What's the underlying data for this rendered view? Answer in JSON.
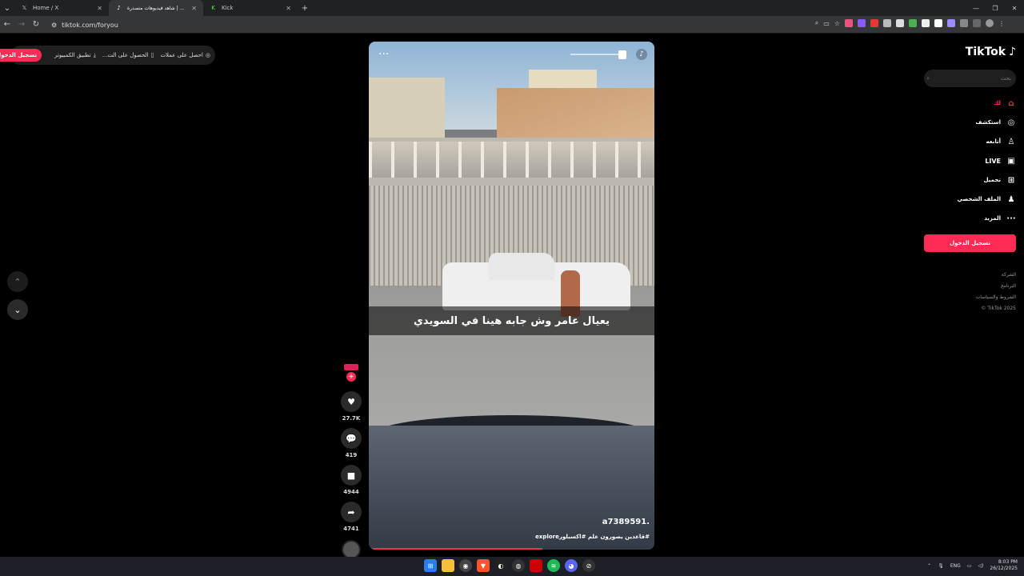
{
  "browser": {
    "tabs": [
      {
        "title": "Home / X",
        "favicon": "x-logo"
      },
      {
        "title": "شاهد فيديوهات متصدرة | ...",
        "favicon": "tiktok-logo"
      },
      {
        "title": "Kick",
        "favicon": "kick-logo"
      }
    ],
    "url": "tiktok.com/foryou"
  },
  "topbar": {
    "get_coins": "احصل على عملات",
    "get_app": "الحصول على الت...",
    "pc_app": "تطبيق الكمبيوتر",
    "login": "تسجيل الدخول"
  },
  "video": {
    "caption": "يعيال عامر وش جابه هينا في السويدي",
    "author": "a7389591.",
    "description": "#قاعدين يصورون علم #اكسبلورexplore",
    "progress": 0.61
  },
  "actions": {
    "likes": "27.7K",
    "comments": "419",
    "saves": "4944",
    "shares": "4741"
  },
  "sidebar": {
    "logo_text": "TikTok",
    "search_placeholder": "بحث",
    "items": [
      {
        "label": "لك",
        "icon": "home-icon"
      },
      {
        "label": "استكشف",
        "icon": "compass-icon"
      },
      {
        "label": "أتابعه",
        "icon": "following-icon"
      },
      {
        "label": "LIVE",
        "icon": "live-icon"
      },
      {
        "label": "تحميل",
        "icon": "upload-icon"
      },
      {
        "label": "الملف الشخصي",
        "icon": "profile-icon"
      },
      {
        "label": "المزيد",
        "icon": "more-icon"
      }
    ],
    "login": "تسجيل الدخول",
    "footer": [
      "الشركة",
      "البرنامج",
      "الشروط والسياسات",
      "TikTok 2025 ©"
    ]
  },
  "taskbar": {
    "lang": "ENG",
    "time": "8:03 PM",
    "date": "26/12/2025"
  }
}
